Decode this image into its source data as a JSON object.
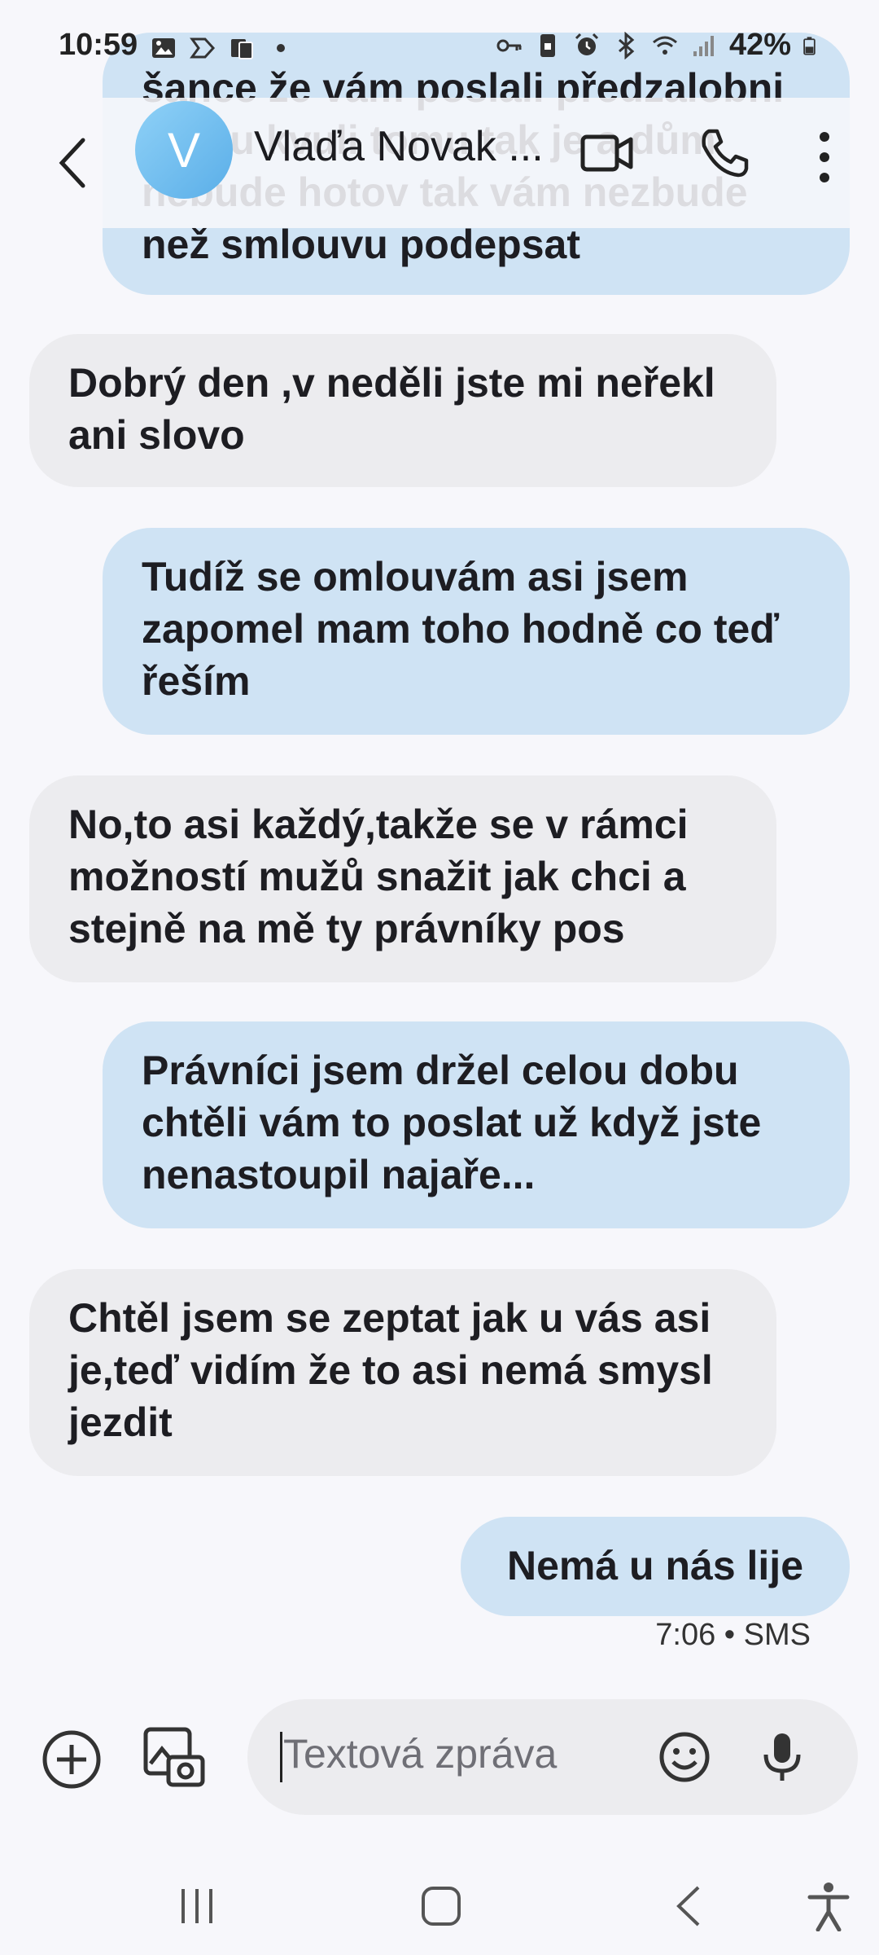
{
  "status_bar": {
    "time": "10:59",
    "battery": "42%"
  },
  "header": {
    "avatar_letter": "V",
    "contact_name": "Vlaďa Novak ..."
  },
  "messages": [
    {
      "direction": "out",
      "text": "šance že vám poslali předzalobni výzvu kvuli tomu tak je a dům nebude hotov tak vám nezbude než smlouvu podepsat"
    },
    {
      "direction": "in",
      "text": "Dobrý den ,v neděli jste mi neřekl ani slovo"
    },
    {
      "direction": "out",
      "text": "Tudíž se omlouvám asi jsem zapomel mam toho hodně co teď řeším"
    },
    {
      "direction": "in",
      "text": "No,to asi každý,takže se v rámci možností mužů snažit jak chci a stejně na mě ty právníky pos"
    },
    {
      "direction": "out",
      "text": "Právníci jsem držel celou dobu chtěli vám to poslat už když jste nenastoupil najaře..."
    },
    {
      "direction": "in",
      "text": "Chtěl jsem se zeptat jak u vás asi je,teď vidím že to asi nemá smysl jezdit"
    },
    {
      "direction": "out",
      "text": "Nemá u nás lije"
    }
  ],
  "last_message_meta": "7:06 • SMS",
  "composer": {
    "placeholder": "Textová zpráva"
  },
  "colors": {
    "outgoing_bubble": "#cfe3f4",
    "incoming_bubble": "#ececef",
    "background": "#f7f7fb"
  }
}
